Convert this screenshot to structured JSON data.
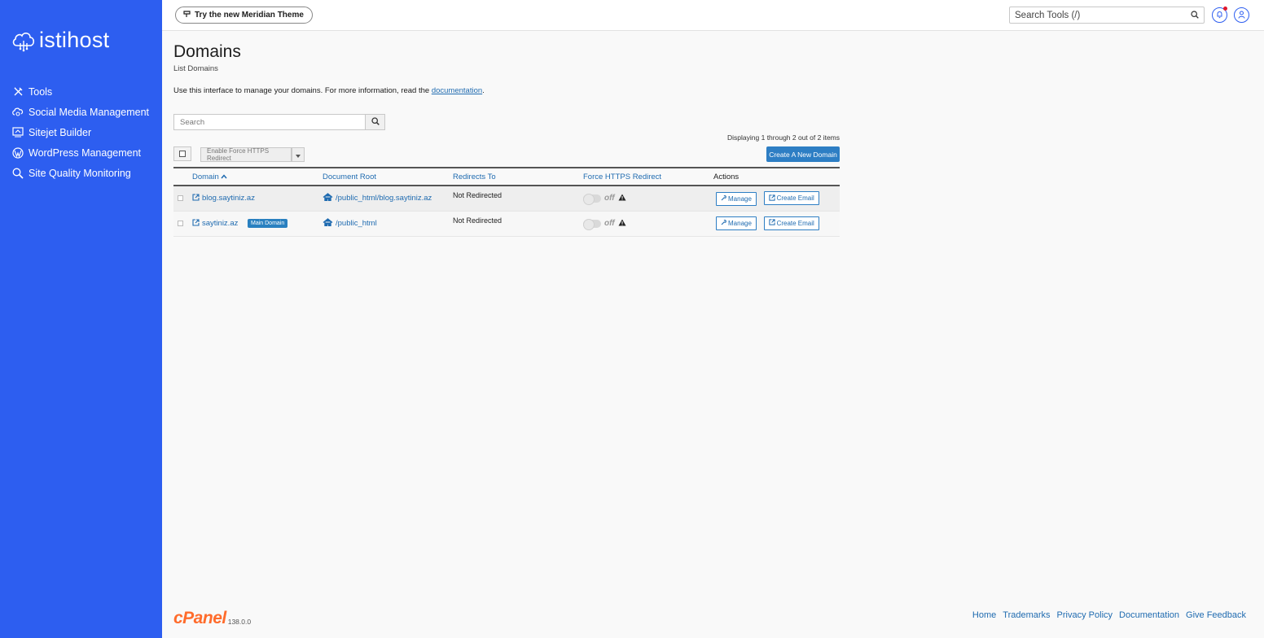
{
  "brand": {
    "name": "istihost"
  },
  "sidebar": {
    "items": [
      {
        "label": "Tools",
        "icon": "tools-icon"
      },
      {
        "label": "Social Media Management",
        "icon": "social-icon"
      },
      {
        "label": "Sitejet Builder",
        "icon": "sitejet-icon"
      },
      {
        "label": "WordPress Management",
        "icon": "wordpress-icon"
      },
      {
        "label": "Site Quality Monitoring",
        "icon": "magnifier-icon"
      }
    ]
  },
  "topbar": {
    "theme_button": "Try the new Meridian Theme",
    "search_placeholder": "Search Tools (/)"
  },
  "page": {
    "title": "Domains",
    "subtitle": "List Domains",
    "intro_prefix": "Use this interface to manage your domains. For more information, read the ",
    "intro_link": "documentation",
    "intro_suffix": "."
  },
  "toolbar": {
    "search_placeholder": "Search",
    "displaying": "Displaying 1 through 2 out of 2 items",
    "bulk_action": "Enable Force HTTPS Redirect",
    "create_button": "Create A New Domain"
  },
  "table": {
    "columns": {
      "domain": "Domain",
      "document_root": "Document Root",
      "redirects_to": "Redirects To",
      "force_https": "Force HTTPS Redirect",
      "actions": "Actions"
    },
    "rows": [
      {
        "domain": "blog.saytiniz.az",
        "badge": "",
        "document_root": "/public_html/blog.saytiniz.az",
        "redirects_to": "Not Redirected",
        "force_https": "off",
        "manage": "Manage",
        "create_email": "Create Email"
      },
      {
        "domain": "saytiniz.az",
        "badge": "Main Domain",
        "document_root": "/public_html",
        "redirects_to": "Not Redirected",
        "force_https": "off",
        "manage": "Manage",
        "create_email": "Create Email"
      }
    ]
  },
  "footer": {
    "logo": "cPanel",
    "version": "138.0.0",
    "links": [
      "Home",
      "Trademarks",
      "Privacy Policy",
      "Documentation",
      "Give Feedback"
    ]
  },
  "colors": {
    "sidebar": "#2d5ef0",
    "link": "#1f6bb0",
    "primary_button": "#2d7ec4",
    "cpanel_orange": "#ff6c2c"
  }
}
